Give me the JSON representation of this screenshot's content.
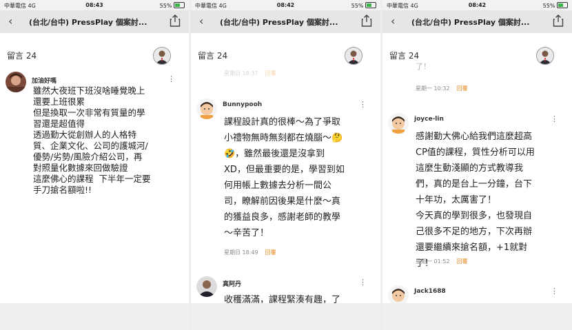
{
  "status": {
    "carrier": "中華電信 4G",
    "battery": "55%"
  },
  "times": [
    "08:43",
    "08:42",
    "08:42"
  ],
  "nav_title": "(台北/台中) PressPlay 個案討...",
  "comments_header": "留言 24",
  "icons": {
    "back": "chevron-left-icon",
    "share": "share-icon",
    "more": "more-vertical-icon"
  },
  "accent_color": "#e08a1e",
  "panel1": {
    "comment": {
      "username": "加油好嗎",
      "body": "雖然大夜班下班沒啥睡覺晚上\n還要上班很累\n但是換取一次非常有質量的學\n習還是超值得\n透過勤大從創辦人的人格特\n質、企業文化、公司的護城河/\n優勢/劣勢/風險介紹公司，再\n對照量化數據來回做驗證\n這麼佛心的課程  下半年一定要\n手刀搶名額啦!!"
    }
  },
  "panel2": {
    "prev_meta": {
      "day": "星期日 18:37",
      "reply": "回覆"
    },
    "comment1": {
      "username": "Bunnypooh",
      "body": "課程設計真的很棒～為了爭取\n小禮物無時無刻都在燒腦～🤔\n🤣，雖然最後還是沒拿到\nXD，但最重要的是，學習到如\n何用帳上數據去分析一間公\n司，瞭解前因後果是什麼～真\n的獲益良多，感謝老師的教學\n～辛苦了！",
      "day": "星期日 18:49",
      "reply": "回覆"
    },
    "comment2": {
      "username": "真阿丹",
      "body": "收穫滿滿，課程緊湊有趣，了"
    }
  },
  "panel3": {
    "prev_text": "了！",
    "prev_meta": {
      "day": "星期一 10:32",
      "reply": "回覆"
    },
    "comment1": {
      "username": "joyce-lin",
      "body": "感謝勤大佛心給我們這麼超高\nCP值的課程，質性分析可以用\n這麼生動淺顯的方式教導我\n們，真的是台上一分鐘，台下\n十年功，太厲害了！\n今天真的學到很多，也發現自\n己很多不足的地方，下次再辦\n還要繼續來搶名額，+1就對\n了！",
      "day": "星期一 01:52",
      "reply": "回覆"
    },
    "comment2": {
      "username": "Jack1688"
    }
  }
}
